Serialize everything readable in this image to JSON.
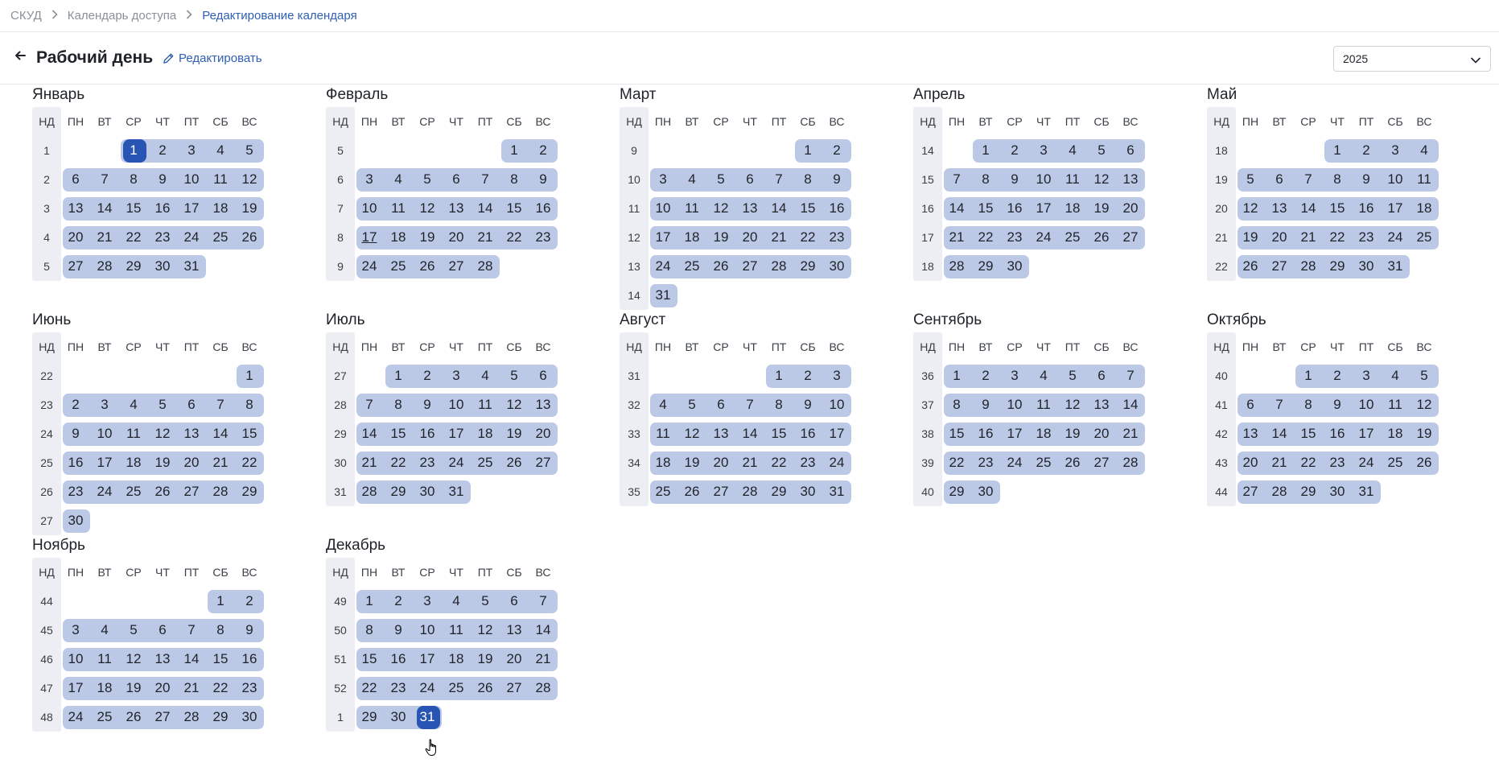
{
  "breadcrumb": {
    "items": [
      "СКУД",
      "Календарь доступа",
      "Редактирование календаря"
    ]
  },
  "header": {
    "title": "Рабочий день",
    "edit_label": "Редактировать",
    "year": "2025"
  },
  "weekday_headers": [
    "НД",
    "ПН",
    "ВТ",
    "СР",
    "ЧТ",
    "ПТ",
    "СБ",
    "ВС"
  ],
  "months": [
    {
      "name": "Январь",
      "offset": 2,
      "days": 31,
      "weeks": [
        1,
        2,
        3,
        4,
        5
      ],
      "selected": [
        1
      ]
    },
    {
      "name": "Февраль",
      "offset": 5,
      "days": 28,
      "weeks": [
        5,
        6,
        7,
        8,
        9
      ],
      "today": 17
    },
    {
      "name": "Март",
      "offset": 5,
      "days": 31,
      "weeks": [
        9,
        10,
        11,
        12,
        13,
        14
      ]
    },
    {
      "name": "Апрель",
      "offset": 1,
      "days": 30,
      "weeks": [
        14,
        15,
        16,
        17,
        18
      ]
    },
    {
      "name": "Май",
      "offset": 3,
      "days": 31,
      "weeks": [
        18,
        19,
        20,
        21,
        22
      ]
    },
    {
      "name": "Июнь",
      "offset": 6,
      "days": 30,
      "weeks": [
        22,
        23,
        24,
        25,
        26,
        27
      ]
    },
    {
      "name": "Июль",
      "offset": 1,
      "days": 31,
      "weeks": [
        27,
        28,
        29,
        30,
        31
      ]
    },
    {
      "name": "Август",
      "offset": 4,
      "days": 31,
      "weeks": [
        31,
        32,
        33,
        34,
        35
      ]
    },
    {
      "name": "Сентябрь",
      "offset": 0,
      "days": 30,
      "weeks": [
        36,
        37,
        38,
        39,
        40
      ]
    },
    {
      "name": "Октябрь",
      "offset": 2,
      "days": 31,
      "weeks": [
        40,
        41,
        42,
        43,
        44
      ]
    },
    {
      "name": "Ноябрь",
      "offset": 5,
      "days": 30,
      "weeks": [
        44,
        45,
        46,
        47,
        48
      ]
    },
    {
      "name": "Декабрь",
      "offset": 0,
      "days": 31,
      "weeks": [
        49,
        50,
        51,
        52,
        1
      ],
      "selected": [
        31
      ]
    }
  ],
  "colors": {
    "accent": "#2f5fb3",
    "day_highlight": "#bcc9e6",
    "selected_day": "#2855b4",
    "week_column": "#eceef3"
  }
}
